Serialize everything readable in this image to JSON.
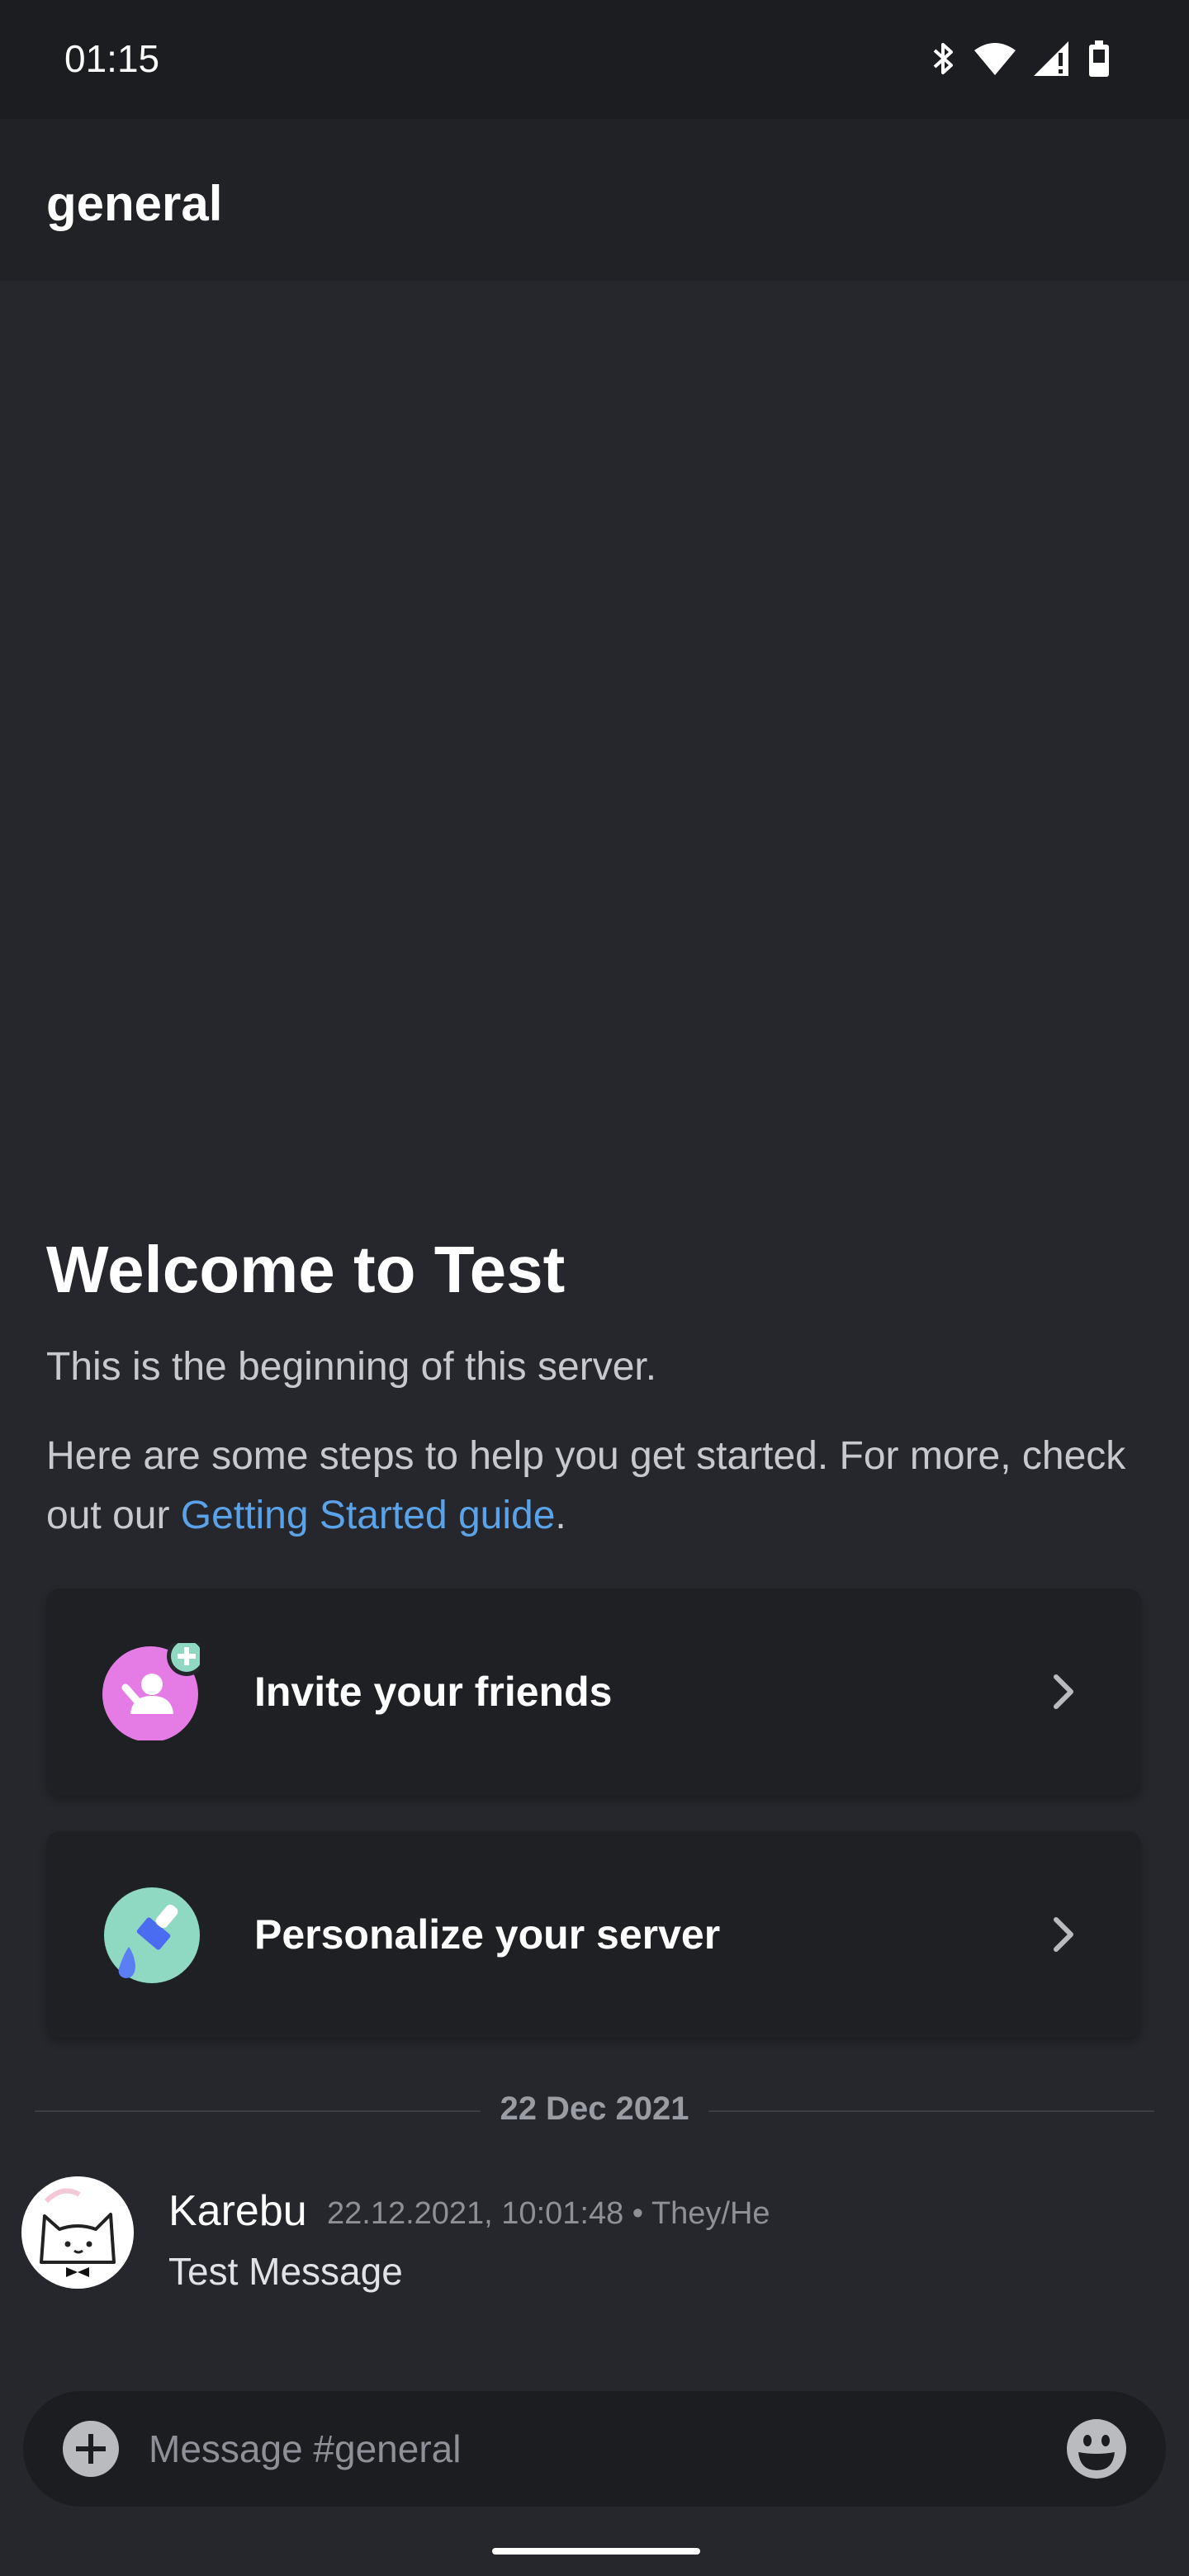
{
  "status_bar": {
    "time": "01:15",
    "icons": [
      "bluetooth-icon",
      "wifi-icon",
      "signal-icon",
      "battery-icon"
    ]
  },
  "header": {
    "channel_name": "general"
  },
  "welcome": {
    "title": "Welcome to Test",
    "subtitle": "This is the beginning of this server.",
    "help_text_before": "Here are some steps to help you get started. For more, check out our ",
    "help_link": "Getting Started guide",
    "help_text_after": "."
  },
  "cards": [
    {
      "label": "Invite your friends",
      "icon": "invite-friends-icon",
      "color": "#e57ce6"
    },
    {
      "label": "Personalize your server",
      "icon": "paintbrush-icon",
      "color": "#8fd9c2"
    }
  ],
  "date_divider": "22 Dec 2021",
  "message": {
    "author": "Karebu",
    "meta": "22.12.2021, 10:01:48 • They/He",
    "text": "Test Message"
  },
  "composer": {
    "placeholder": "Message #general"
  },
  "colors": {
    "background": "#26272c",
    "header": "#212226",
    "link": "#5aa3e8"
  }
}
